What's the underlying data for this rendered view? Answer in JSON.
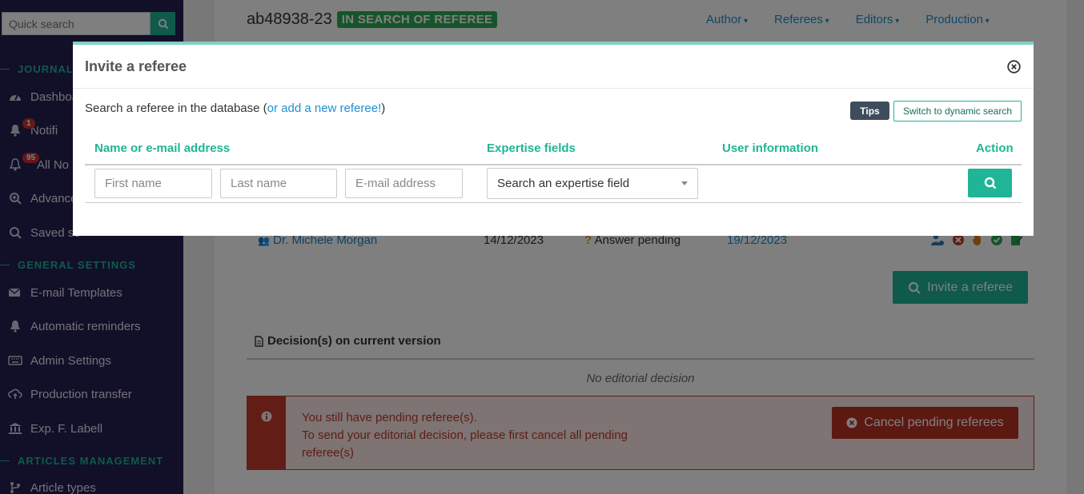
{
  "sidebar": {
    "search_placeholder": "Quick search",
    "sections": {
      "journal": "JOURNAL (",
      "general": "GENERAL SETTINGS",
      "articles": "ARTICLES MANAGEMENT"
    },
    "items": [
      {
        "label": "Dashboa",
        "icon": "gauge-icon"
      },
      {
        "label": "Notifi",
        "icon": "bell-icon",
        "badge": "1"
      },
      {
        "label": "All No",
        "icon": "bell-icon",
        "badge": "95"
      },
      {
        "label": "Advance",
        "icon": "search-plus-icon"
      },
      {
        "label": "Saved se",
        "icon": "search-icon"
      },
      {
        "label": "E-mail Templates",
        "icon": "email-template-icon"
      },
      {
        "label": "Automatic reminders",
        "icon": "bell-icon"
      },
      {
        "label": "Admin Settings",
        "icon": "keyboard-icon"
      },
      {
        "label": "Production transfer",
        "icon": "cloud-upload-icon"
      },
      {
        "label": "Exp. F. Labell",
        "icon": "bank-icon"
      },
      {
        "label": "Article types",
        "icon": "branch-icon"
      }
    ]
  },
  "header": {
    "manuscript_id": "ab48938-23",
    "status": "IN SEARCH OF REFEREE",
    "nav": [
      "Author",
      "Referees",
      "Editors",
      "Production"
    ]
  },
  "referee_row": {
    "name": "Dr. Michele Morgan",
    "date": "14/12/2023",
    "status": "Answer pending",
    "due": "19/12/2023"
  },
  "invite_button": "Invite a referee",
  "decision": {
    "heading": "Decision(s) on current version",
    "empty": "No editorial decision"
  },
  "alert": {
    "line1": "You still have pending referee(s).",
    "line2": "To send your editorial decision, please first cancel all pending referee(s)",
    "button": "Cancel pending referees"
  },
  "modal": {
    "title": "Invite a referee",
    "intro_prefix": "Search a referee in the database (",
    "intro_link": "or add a new referee!",
    "intro_suffix": ")",
    "tips": "Tips",
    "dynamic_search": "Switch to dynamic search",
    "columns": [
      "Name or e-mail address",
      "Expertise fields",
      "User information",
      "Action"
    ],
    "first_name_placeholder": "First name",
    "last_name_placeholder": "Last name",
    "email_placeholder": "E-mail address",
    "expertise_placeholder": "Search an expertise field"
  },
  "colors": {
    "accent": "#1fb596",
    "sidebar": "#241f52",
    "danger": "#c53b2c",
    "link": "#1e8fd1"
  }
}
